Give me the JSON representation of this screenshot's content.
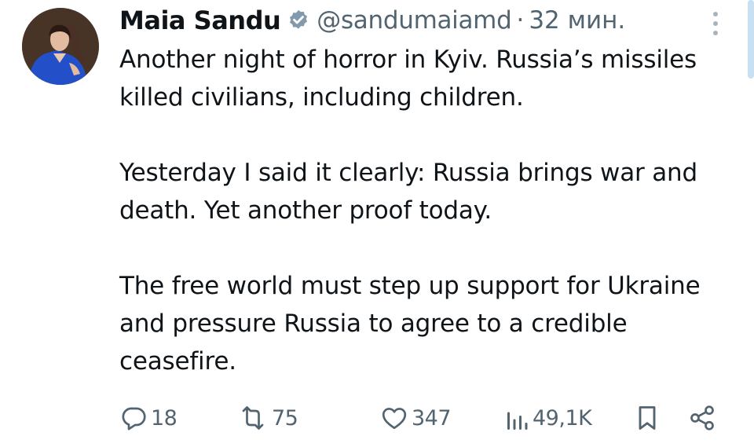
{
  "tweet": {
    "author_name": "Maia Sandu",
    "handle": "@sandumaiamd",
    "separator": "·",
    "time": "32 мин.",
    "paragraphs": [
      "Another night of horror in Kyiv. Russia’s missiles killed civilians, including children.",
      "Yesterday I said it clearly: Russia brings war and death. Yet another proof today.",
      "The free world must step up support for Ukraine and pressure Russia to agree to a credible ceasefire."
    ]
  },
  "icons": {
    "verified": "verified-badge-icon",
    "more": "more-vertical-icon",
    "reply": "reply-icon",
    "repost": "repost-icon",
    "like": "like-icon",
    "views": "views-icon",
    "bookmark": "bookmark-icon",
    "share": "share-icon"
  },
  "actions": {
    "replies": "18",
    "reposts": "75",
    "likes": "347",
    "views": "49,1K"
  },
  "colors": {
    "text": "#0f1419",
    "secondary": "#536471",
    "avatar_background": "#3d2a22",
    "avatar_jacket": "#2350c8"
  }
}
